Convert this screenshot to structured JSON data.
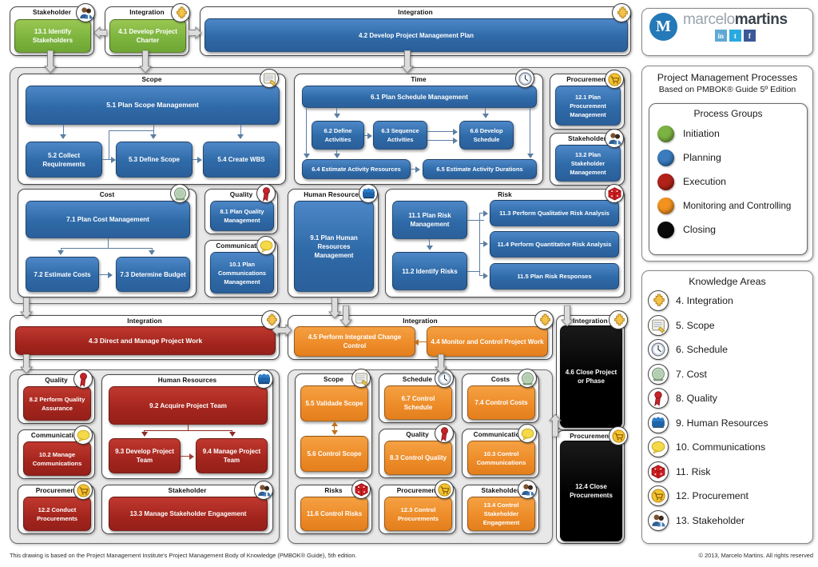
{
  "footer": {
    "left": "This drawing is based on the Project Management Institute's Project Management Body of Knowledge (PMBOK® Guide), 5th edition.",
    "right": "© 2013, Marcelo Martins. All rights reserved"
  },
  "brand": {
    "name_light": "marcelo",
    "name_bold": "martins",
    "logo_letter": "M",
    "social": [
      {
        "name": "linkedin-icon",
        "glyph": "in",
        "color": "#5fa8d3"
      },
      {
        "name": "twitter-icon",
        "glyph": "t",
        "color": "#29a9e0"
      },
      {
        "name": "facebook-icon",
        "glyph": "f",
        "color": "#3b5998"
      }
    ]
  },
  "title_card": {
    "title": "Project Management Processes",
    "subtitle": "Based on PMBOK® Guide 5º Edition"
  },
  "process_groups": {
    "title": "Process Groups",
    "items": [
      {
        "label": "Initiation",
        "color": "#7cb342"
      },
      {
        "label": "Planning",
        "color": "#3a7cbe"
      },
      {
        "label": "Execution",
        "color": "#b32219"
      },
      {
        "label": "Monitoring and Controlling",
        "color": "#f2921f"
      },
      {
        "label": "Closing",
        "color": "#0a0a0a"
      }
    ]
  },
  "knowledge_areas": {
    "title": "Knowledge Areas",
    "items": [
      {
        "label": "4. Integration",
        "icon": "puzzle-icon"
      },
      {
        "label": "5. Scope",
        "icon": "scroll-icon"
      },
      {
        "label": "6. Schedule",
        "icon": "clock-icon"
      },
      {
        "label": "7. Cost",
        "icon": "coin-icon"
      },
      {
        "label": "8. Quality",
        "icon": "ribbon-icon"
      },
      {
        "label": "9. Human Resources",
        "icon": "people-icon"
      },
      {
        "label": "10. Communications",
        "icon": "speech-icon"
      },
      {
        "label": "11. Risk",
        "icon": "dice-icon"
      },
      {
        "label": "12. Procurement",
        "icon": "cart-icon"
      },
      {
        "label": "13. Stakeholder",
        "icon": "stakeholder-icon"
      }
    ]
  },
  "groups": {
    "stakeholder_init": "Stakeholder",
    "integration_init": "Integration",
    "integration_plan": "Integration",
    "scope": "Scope",
    "time": "Time",
    "procurement": "Procurement",
    "stakeholder": "Stakeholder",
    "cost": "Cost",
    "quality": "Quality",
    "communication": "Communication",
    "human_resources": "Human Resources",
    "risk": "Risk",
    "integration_exec": "Integration",
    "integration_mon": "Integration",
    "integration_close": "Integration",
    "procurement_close": "Procurement",
    "quality_exec": "Quality",
    "hr_exec": "Human Resources",
    "communication_exec": "Communication",
    "procurement_exec": "Procurement",
    "stakeholder_exec": "Stakeholder",
    "scope_mon": "Scope",
    "schedule_mon": "Schedule",
    "costs_mon": "Costs",
    "quality_mon": "Quality",
    "communications_mon": "Communications",
    "risks_mon": "Risks",
    "procurement_mon": "Procurement",
    "stakeholder_mon": "Stakeholder"
  },
  "processes": {
    "p131": "13.1 Identify Stakeholders",
    "p41": "4.1 Develop Project Charter",
    "p42": "4.2 Develop Project Management Plan",
    "p51": "5.1 Plan Scope Management",
    "p52": "5.2 Collect Requirements",
    "p53": "5.3 Define Scope",
    "p54": "5.4 Create WBS",
    "p61": "6.1 Plan Schedule Management",
    "p62": "6.2 Define Activities",
    "p63": "6.3 Sequence Activities",
    "p66": "6.6 Develop Schedule",
    "p64": "6.4 Estimate Activity Resources",
    "p65": "6.5 Estimate Activity Durations",
    "p121": "12.1 Plan Procurement Management",
    "p132": "13.2 Plan Stakeholder Management",
    "p71": "7.1 Plan Cost Management",
    "p72": "7.2 Estimate Costs",
    "p73": "7.3  Determine Budget",
    "p81": "8.1 Plan Quality Management",
    "p101": "10.1 Plan Communications Management",
    "p91": "9.1 Plan Human Resources Management",
    "p111": "11.1 Plan Risk Management",
    "p112": "11.2 Identify Risks",
    "p113": "11.3  Perform Qualitative Risk Analysis",
    "p114": "11.4  Perform Quantitative Risk Analysis",
    "p115": "11.5  Plan Risk Responses",
    "p43": "4.3 Direct and Manage Project Work",
    "p45": "4.5 Perform Integrated Change Control",
    "p44": "4.4 Monitor and Control Project Work",
    "p46": "4.6 Close Project or Phase",
    "p124": "12.4 Close Procurements",
    "p82": "8.2 Perform Quality Assurance",
    "p102": "10.2 Manage Communications",
    "p122": "12.2 Conduct Procurements",
    "p92": "9.2 Acquire Project Team",
    "p93": "9.3  Develop Project Team",
    "p94": "9.4 Manage Project Team",
    "p133": "13.3  Manage Stakeholder Engagement",
    "p55": "5.5 Validade Scope",
    "p56": "5.6 Control Scope",
    "p67": "6.7 Control Schedule",
    "p74": "7.4 Control Costs",
    "p83": "8.3  Control Quality",
    "p103": "10.3  Control Communications",
    "p116": "11.6 Control Risks",
    "p123": "12.3  Control Procurements",
    "p134": "13.4 Control Stakeholder Engagement"
  }
}
